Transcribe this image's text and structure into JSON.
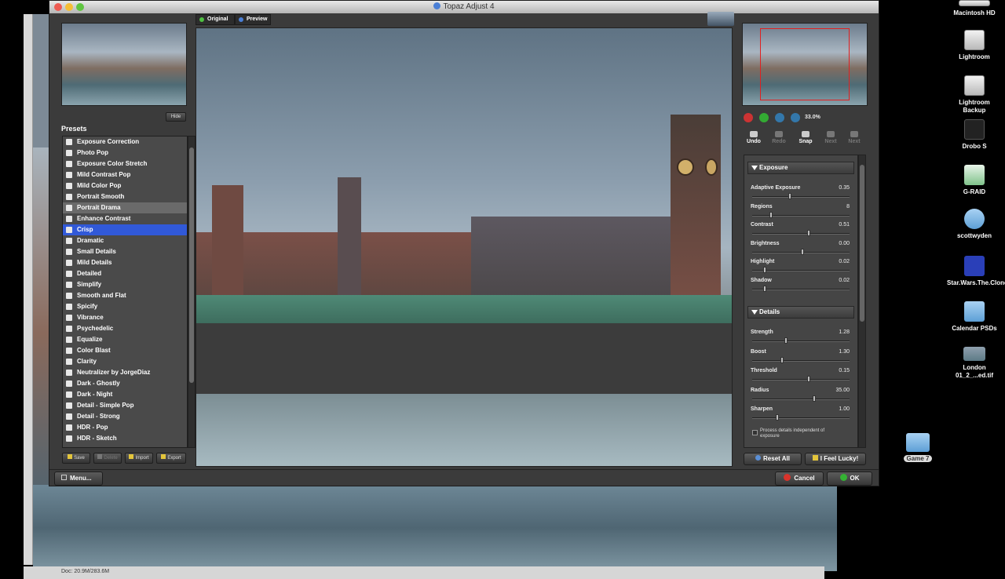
{
  "window": {
    "title": "Topaz Adjust 4"
  },
  "view_tabs": [
    {
      "label": "Original"
    },
    {
      "label": "Preview"
    }
  ],
  "left": {
    "hide_label": "Hide",
    "presets_title": "Presets",
    "presets": [
      "Exposure Correction",
      "Photo Pop",
      "Exposure Color Stretch",
      "Mild Contrast Pop",
      "Mild Color Pop",
      "Portrait Smooth",
      "Portrait Drama",
      "Enhance Contrast",
      "Crisp",
      "Dramatic",
      "Small Details",
      "Mild Details",
      "Detailed",
      "Simplify",
      "Smooth and Flat",
      "Spicify",
      "Vibrance",
      "Psychedelic",
      "Equalize",
      "Color Blast",
      "Clarity",
      "Neutralizer by JorgeDiaz",
      "Dark - Ghostly",
      "Dark - Night",
      "Detail - Simple Pop",
      "Detail - Strong",
      "HDR - Pop",
      "HDR - Sketch"
    ],
    "highlighted": "Portrait Drama",
    "selected": "Crisp",
    "buttons": [
      {
        "label": "Save"
      },
      {
        "label": "Delete"
      },
      {
        "label": "Import"
      },
      {
        "label": "Export"
      }
    ],
    "menu_label": "Menu..."
  },
  "right": {
    "zoom": "33.0%",
    "tools": [
      {
        "label": "Undo"
      },
      {
        "label": "Redo"
      },
      {
        "label": "Snap"
      },
      {
        "label": "Next"
      },
      {
        "label": "Next"
      }
    ],
    "exposure": {
      "title": "Exposure",
      "sliders": [
        {
          "label": "Adaptive Exposure",
          "value": "0.35",
          "pos": 0.38
        },
        {
          "label": "Regions",
          "value": "8",
          "pos": 0.18
        },
        {
          "label": "Contrast",
          "value": "0.51",
          "pos": 0.58
        },
        {
          "label": "Brightness",
          "value": "0.00",
          "pos": 0.52
        },
        {
          "label": "Highlight",
          "value": "0.02",
          "pos": 0.12
        },
        {
          "label": "Shadow",
          "value": "0.02",
          "pos": 0.12
        }
      ]
    },
    "details": {
      "title": "Details",
      "sliders": [
        {
          "label": "Strength",
          "value": "1.28",
          "pos": 0.34
        },
        {
          "label": "Boost",
          "value": "1.30",
          "pos": 0.3
        },
        {
          "label": "Threshold",
          "value": "0.15",
          "pos": 0.58
        },
        {
          "label": "Radius",
          "value": "35.00",
          "pos": 0.64
        },
        {
          "label": "Sharpen",
          "value": "1.00",
          "pos": 0.25
        }
      ],
      "checkbox_label": "Process details independent of exposure"
    },
    "reset_label": "Reset All",
    "lucky_label": "I Feel Lucky!"
  },
  "footer": {
    "cancel_label": "Cancel",
    "ok_label": "OK"
  },
  "desktop": [
    {
      "label": "Macintosh HD",
      "kind": "drive"
    },
    {
      "label": "Lightroom",
      "kind": "drive"
    },
    {
      "label": "Lightroom Backup",
      "kind": "drive"
    },
    {
      "label": "Drobo S",
      "kind": "drive"
    },
    {
      "label": "G-RAID",
      "kind": "drive"
    },
    {
      "label": "scottwyden",
      "kind": "folder"
    },
    {
      "label": "Star.Wars.The.Clone....rrent",
      "kind": "app"
    },
    {
      "label": "Calendar PSDs",
      "kind": "folder"
    },
    {
      "label": "London 01_2_...ed.tif",
      "kind": "image"
    },
    {
      "label": "Game 7",
      "kind": "folder"
    }
  ],
  "host_status": "Doc: 20.9M/283.6M",
  "colors": {
    "selection": "#3159d8",
    "cancel_red": "#d9332b",
    "ok_green": "#34b233",
    "window_bg": "#3b3b3b"
  }
}
